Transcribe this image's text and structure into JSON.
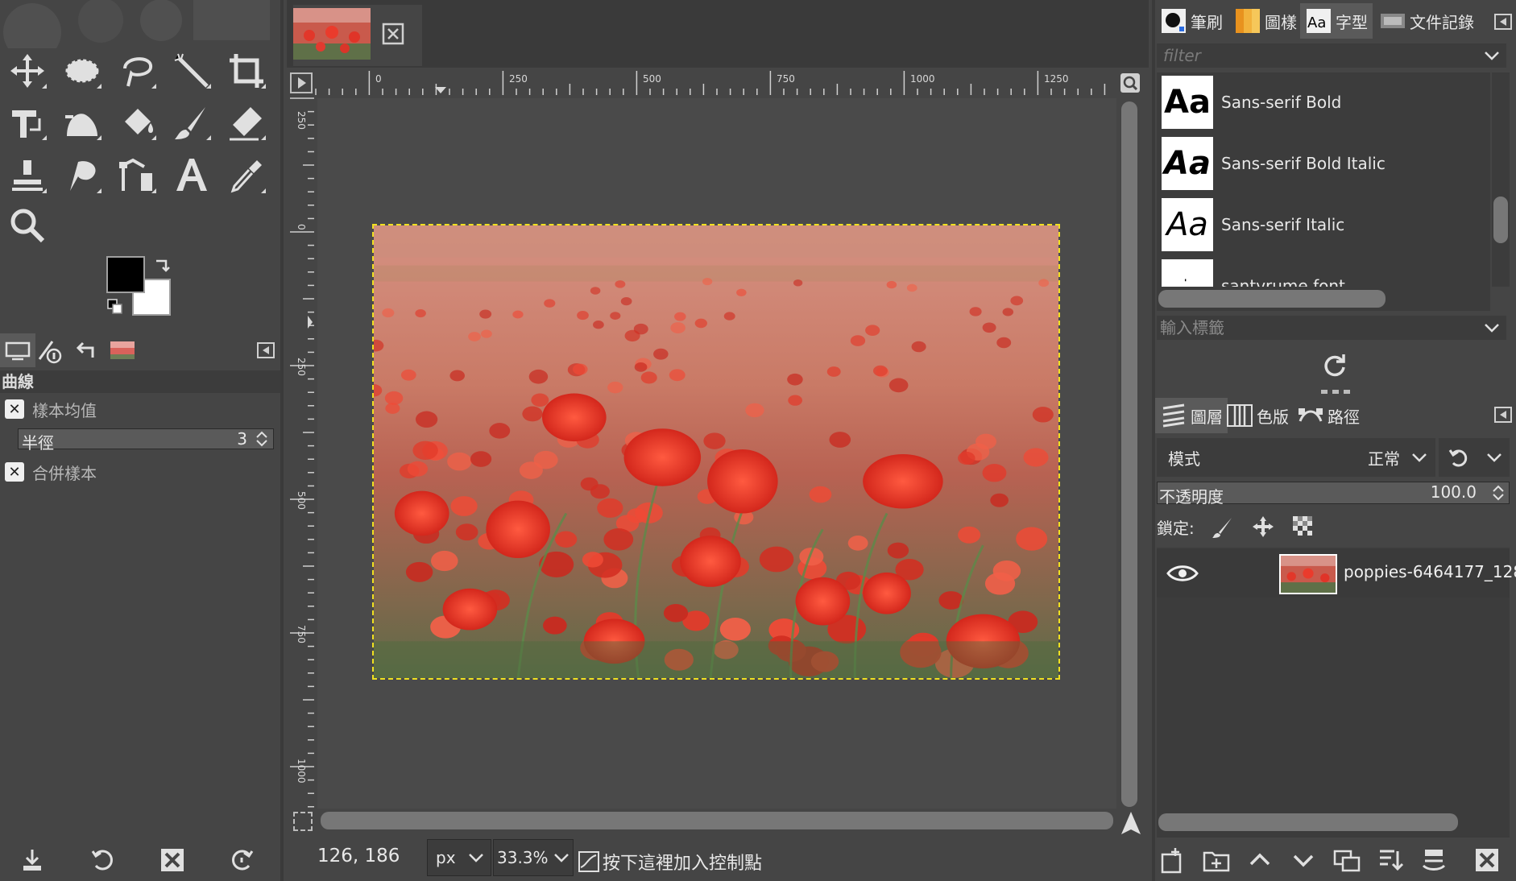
{
  "image_tab": {
    "thumbnail": "poppies-thumbnail",
    "close_icon": "close-icon"
  },
  "tool_options": {
    "title": "曲線",
    "sample_average": "樣本均值",
    "radius_label": "半徑",
    "radius_value": "3",
    "sample_merged": "合併樣本"
  },
  "statusbar": {
    "coords": "126, 186",
    "unit": "px",
    "zoom": "33.3%",
    "message": "按下這裡加入控制點"
  },
  "ruler_h": {
    "labels": [
      "0",
      "250",
      "500",
      "750",
      "1000",
      "1250"
    ]
  },
  "ruler_v": {
    "labels": [
      "250",
      "0",
      "250",
      "500",
      "750",
      "1000"
    ]
  },
  "right_tabs": {
    "brushes": "筆刷",
    "patterns": "圖樣",
    "fonts": "字型",
    "document_history": "文件記錄"
  },
  "fonts_panel": {
    "filter_placeholder": "filter",
    "items": [
      {
        "preview": "Aa",
        "name": "Sans-serif Bold"
      },
      {
        "preview": "Aa",
        "name": "Sans-serif Bold Italic"
      },
      {
        "preview": "Aa",
        "name": "Sans-serif Italic"
      },
      {
        "preview": "ฺ่",
        "name": "santvrume font"
      }
    ],
    "tag_placeholder": "輸入標籤"
  },
  "layers_panel": {
    "tabs": {
      "layers": "圖層",
      "channels": "色版",
      "paths": "路徑"
    },
    "mode_label": "模式",
    "mode_value": "正常",
    "opacity_label": "不透明度",
    "opacity_value": "100.0",
    "lock_label": "鎖定:",
    "layer_name": "poppies-6464177_128"
  },
  "colors": {
    "foreground": "#000000",
    "background": "#ffffff",
    "selection": "#f0e020",
    "panel_bg": "#454545"
  }
}
